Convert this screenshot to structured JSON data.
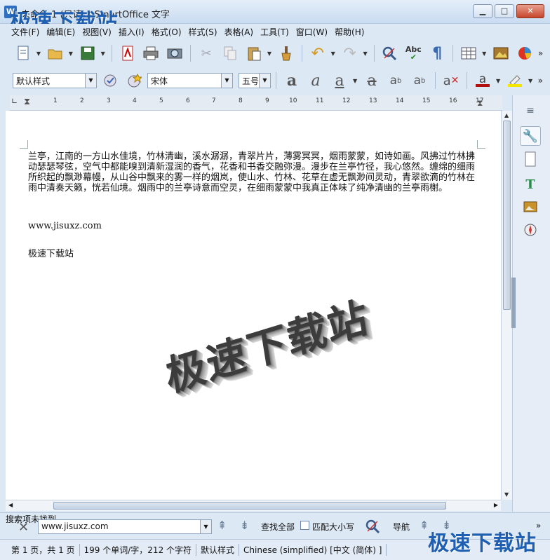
{
  "window": {
    "title": "未命名 1 (只读) - SmartOffice 文字",
    "app_icon": "W",
    "minimize": "▁",
    "maximize": "□",
    "close": "✕"
  },
  "watermark": "极速下载站",
  "menu": [
    "文件(F)",
    "编辑(E)",
    "视图(V)",
    "插入(I)",
    "格式(O)",
    "样式(S)",
    "表格(A)",
    "工具(T)",
    "窗口(W)",
    "帮助(H)"
  ],
  "toolbar1": {
    "icons": [
      "new-document-icon",
      "open-folder-icon",
      "save-icon",
      "export-pdf-icon",
      "print-icon",
      "print-preview-icon",
      "cut-icon",
      "copy-icon",
      "paste-icon",
      "format-paintbrush-icon",
      "undo-icon",
      "redo-icon",
      "find-replace-icon",
      "spellcheck-icon",
      "formatting-marks-icon",
      "table-icon",
      "image-icon",
      "chart-icon"
    ],
    "spellcheck_label": "Abc",
    "more": "»"
  },
  "toolbar2": {
    "style_value": "默认样式",
    "font_value": "宋体",
    "size_value": "五号",
    "more": "»"
  },
  "ruler": {
    "numbers": [
      "1",
      "1",
      "2",
      "3",
      "4",
      "5",
      "6",
      "7",
      "8",
      "9",
      "10",
      "11",
      "12",
      "13",
      "14",
      "15",
      "16",
      "17"
    ]
  },
  "document": {
    "paragraph": "兰亭，江南的一方山水佳境，竹林清幽，溪水潺潺，青翠片片，薄雾冥冥，烟雨蒙蒙，如诗如画。风拂过竹林拂动瑟瑟琴弦，空气中都能嗅到清新湿润的香气，花香和书香交融弥漫。漫步在兰亭竹径，我心悠然。缠绵的细雨所织起的飘渺幕幔，从山谷中飘来的雾一样的烟岚，使山水、竹林、花草在虚无飘渺间灵动，青翠欲滴的竹林在雨中清奏天籁，恍若仙境。烟雨中的兰亭诗意而空灵，在细雨蒙蒙中我真正体味了纯净清幽的兰亭雨榭。",
    "line2": "www.jisuxz.com",
    "line3": "极速下载站",
    "wordart": "极速下载站"
  },
  "findbar": {
    "label": "搜索项未找到",
    "input_value": "www.jisuxz.com",
    "find_all": "查找全部",
    "match_case": "匹配大小写",
    "navigate": "导航"
  },
  "status": {
    "page": "第 1 页，共 1 页",
    "words": "199 个单词/字，212 个字符",
    "style": "默认样式",
    "language": "Chinese (simplified) [中文 (简体) ]"
  }
}
